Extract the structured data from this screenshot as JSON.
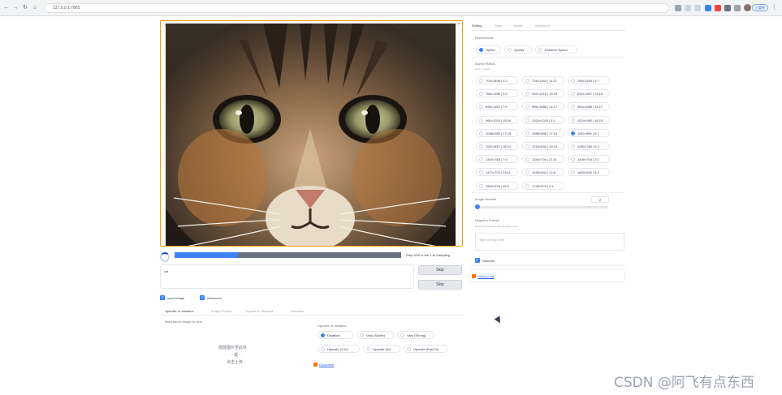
{
  "browser": {
    "url": "127.0.0.1:7865",
    "profile_label": "已暂停"
  },
  "image_panel": {
    "tag": "Preview"
  },
  "progress": {
    "fraction": 0.28,
    "label": "Step 5/30 in the 1-th Sampling"
  },
  "prompt": {
    "value": "cat"
  },
  "buttons": {
    "skip_1": "Skip",
    "skip_2": "Skip"
  },
  "options": {
    "input_image": "Input Image",
    "advanced": "Advanced"
  },
  "left_tabs": [
    "Upscale or Variation",
    "Image Prompt",
    "Inpaint or Outpaint",
    "Describe"
  ],
  "drag_text": "Drag above image to here",
  "drop_area": {
    "line1": "拖放图片至此处",
    "line2": "- 或 -",
    "line3": "点击上传"
  },
  "upscale": {
    "section_label": "Upscale or Variation",
    "options": [
      "Disabled",
      "Vary (Subtle)",
      "Vary (Strong)",
      "Upscale (1.5x)",
      "Upscale (2x)",
      "Upscale (Fast 2x)"
    ],
    "selected": "Disabled",
    "doc_link": "Document"
  },
  "right_panel": {
    "tabs": [
      "Setting",
      "Style",
      "Model",
      "Advanced"
    ],
    "performance_label": "Performance",
    "performance_options": [
      "Speed",
      "Quality",
      "Extreme Speed"
    ],
    "performance_selected": "Speed",
    "aspect_label": "Aspect Ratios",
    "aspect_sub": "width × height",
    "aspect_ratios": [
      "704×1408 | 1:2",
      "704×1344 | 11:21",
      "768×1344 | 4:7",
      "768×1280 | 3:5",
      "832×1216 | 13:19",
      "832×1152 | 13:18",
      "896×1152 | 7:9",
      "896×1088 | 14:17",
      "960×1088 | 15:17",
      "960×1024 | 15:16",
      "1024×1024 | 1:1",
      "1024×960 | 16:15",
      "1088×960 | 17:15",
      "1088×896 | 17:14",
      "1152×896 | 9:7",
      "1152×832 | 18:13",
      "1216×832 | 19:13",
      "1280×768 | 5:3",
      "1344×768 | 7:4",
      "1344×704 | 21:11",
      "1408×704 | 2:1",
      "1472×704 | 23:11",
      "1536×640 | 12:5",
      "1600×640 | 5:2",
      "1664×576 | 26:9",
      "1728×576 | 3:1"
    ],
    "aspect_selected": "1152×896 | 9:7",
    "image_number_label": "Image Number",
    "image_number": "2",
    "negative_label": "Negative Prompt",
    "negative_sub": "Describing what you do not want to see.",
    "negative_placeholder": "Type prompt here.",
    "random_label": "Random",
    "history_link": "History Log"
  },
  "watermark": "CSDN @阿飞有点东西"
}
